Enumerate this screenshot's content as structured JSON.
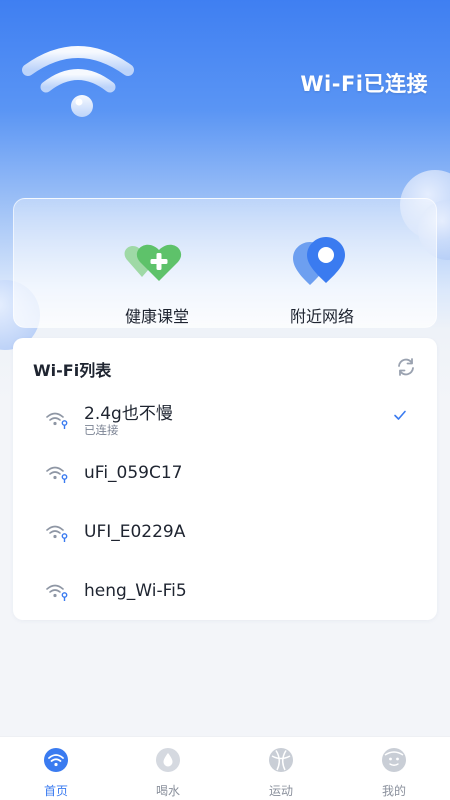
{
  "header": {
    "status_title": "Wi-Fi已连接"
  },
  "quick_actions": [
    {
      "label": "健康课堂",
      "icon": "heart-plus-icon"
    },
    {
      "label": "附近网络",
      "icon": "location-pin-icon"
    }
  ],
  "wifi_list": {
    "title": "Wi-Fi列表",
    "networks": [
      {
        "ssid": "2.4g也不慢",
        "status": "已连接",
        "connected": true
      },
      {
        "ssid": "uFi_059C17",
        "status": "",
        "connected": false
      },
      {
        "ssid": "UFI_E0229A",
        "status": "",
        "connected": false
      },
      {
        "ssid": "heng_Wi-Fi5",
        "status": "",
        "connected": false
      }
    ]
  },
  "tabs": [
    {
      "label": "首页",
      "icon": "wifi-icon",
      "active": true
    },
    {
      "label": "喝水",
      "icon": "water-drop-icon",
      "active": false
    },
    {
      "label": "运动",
      "icon": "ball-icon",
      "active": false
    },
    {
      "label": "我的",
      "icon": "profile-icon",
      "active": false
    }
  ],
  "colors": {
    "accent": "#3a7bf0",
    "header_top": "#3f7ff2",
    "green": "#5ec26a",
    "text": "#1e2430",
    "subtext": "#7c8494"
  }
}
